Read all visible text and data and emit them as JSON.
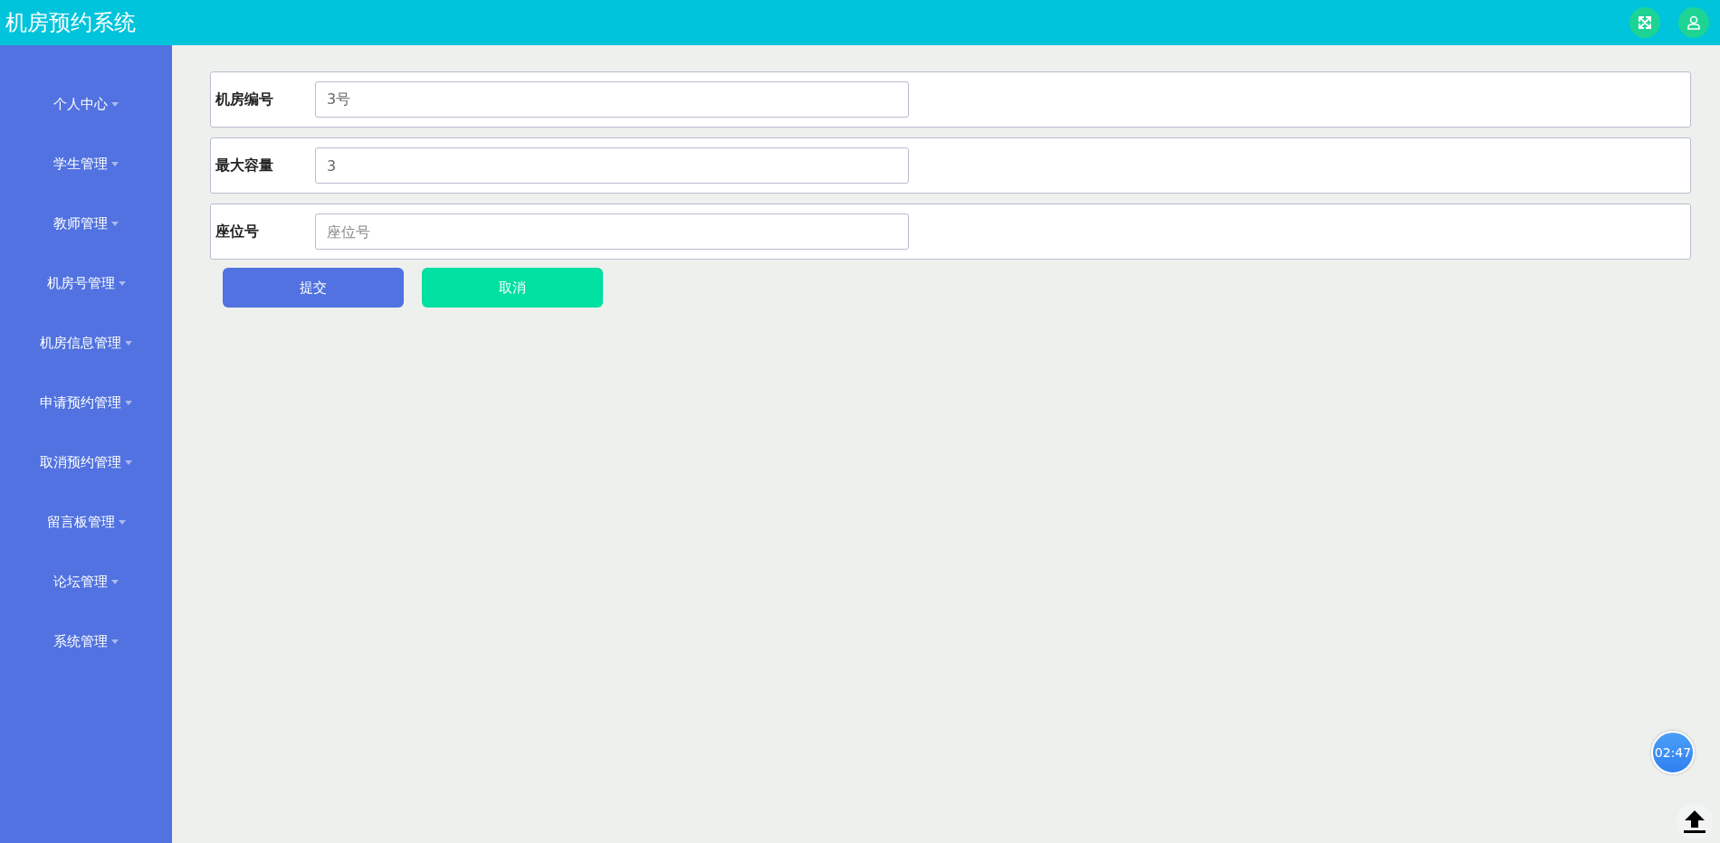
{
  "header": {
    "title": "机房预约系统"
  },
  "sidebar": {
    "items": [
      {
        "label": "个人中心"
      },
      {
        "label": "学生管理"
      },
      {
        "label": "教师管理"
      },
      {
        "label": "机房号管理"
      },
      {
        "label": "机房信息管理"
      },
      {
        "label": "申请预约管理"
      },
      {
        "label": "取消预约管理"
      },
      {
        "label": "留言板管理"
      },
      {
        "label": "论坛管理"
      },
      {
        "label": "系统管理"
      }
    ]
  },
  "form": {
    "fields": [
      {
        "label": "机房编号",
        "value": "3号"
      },
      {
        "label": "最大容量",
        "value": "3"
      },
      {
        "label": "座位号",
        "placeholder": "座位号"
      }
    ],
    "buttons": [
      {
        "label": "提交",
        "kind": "primary"
      },
      {
        "label": "取消",
        "kind": "secondary"
      }
    ]
  },
  "timer": "02:47"
}
